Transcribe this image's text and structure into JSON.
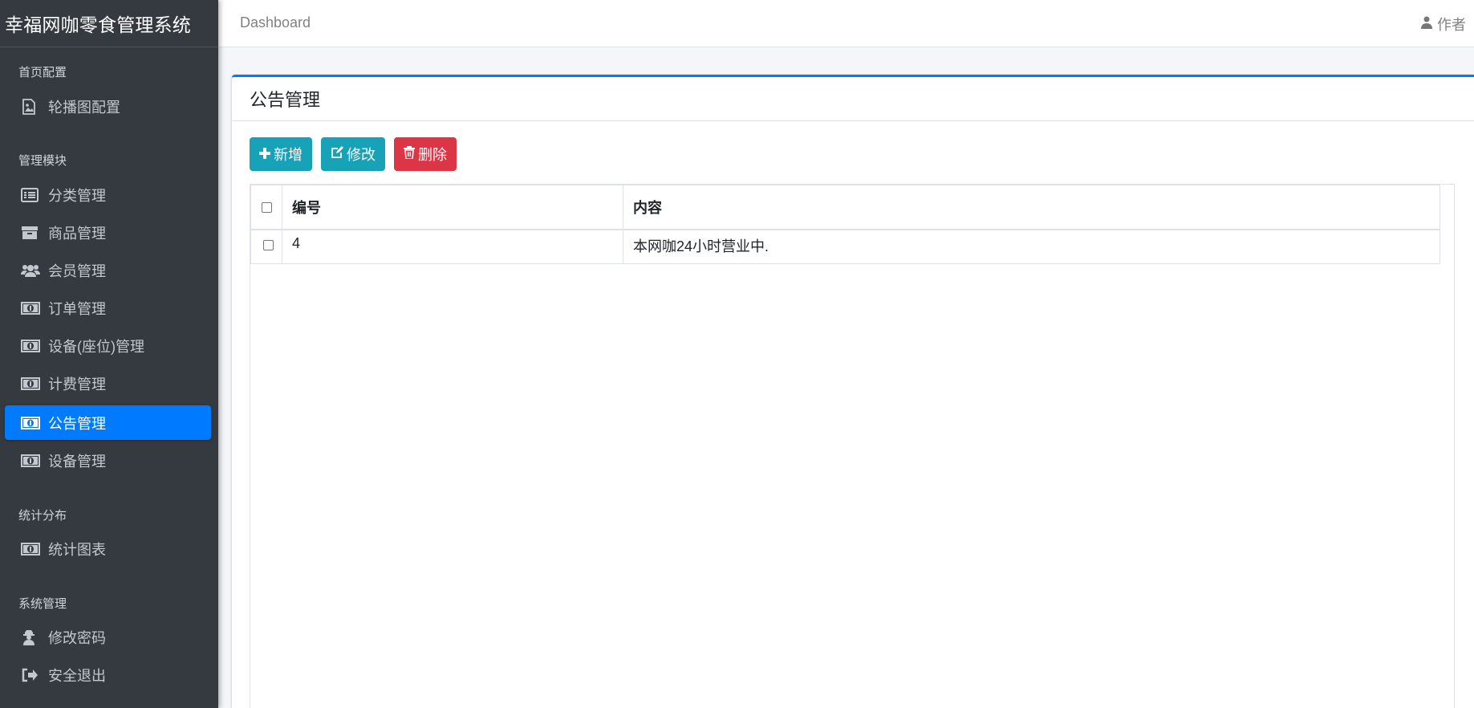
{
  "brand": {
    "title": "幸福网咖零食管理系统"
  },
  "sidebar": {
    "sections": [
      {
        "header": "首页配置",
        "items": [
          {
            "label": "轮播图配置",
            "icon": "image-icon"
          }
        ]
      },
      {
        "header": "管理模块",
        "items": [
          {
            "label": "分类管理",
            "icon": "list-alt-icon"
          },
          {
            "label": "商品管理",
            "icon": "archive-icon"
          },
          {
            "label": "会员管理",
            "icon": "users-icon"
          },
          {
            "label": "订单管理",
            "icon": "money-bill-icon"
          },
          {
            "label": "设备(座位)管理",
            "icon": "money-bill-icon"
          },
          {
            "label": "计费管理",
            "icon": "money-bill-icon"
          },
          {
            "label": "公告管理",
            "icon": "money-bill-icon",
            "active": true
          },
          {
            "label": "设备管理",
            "icon": "money-bill-icon"
          }
        ]
      },
      {
        "header": "统计分布",
        "items": [
          {
            "label": "统计图表",
            "icon": "money-bill-icon"
          }
        ]
      },
      {
        "header": "系统管理",
        "items": [
          {
            "label": "修改密码",
            "icon": "user-secret-icon"
          },
          {
            "label": "安全退出",
            "icon": "sign-out-icon"
          }
        ]
      }
    ],
    "active_color": "#007bff",
    "background": "#343a40"
  },
  "topbar": {
    "breadcrumb": "Dashboard",
    "user": "作者"
  },
  "card": {
    "title": "公告管理",
    "toolbar": {
      "add_label": "新增",
      "edit_label": "修改",
      "delete_label": "删除"
    },
    "table": {
      "columns": [
        "编号",
        "内容"
      ],
      "rows": [
        {
          "id": "4",
          "content": "本网咖24小时营业中."
        }
      ]
    }
  },
  "colors": {
    "primary": "#007bff",
    "info": "#17a2b8",
    "danger": "#dc3545"
  }
}
